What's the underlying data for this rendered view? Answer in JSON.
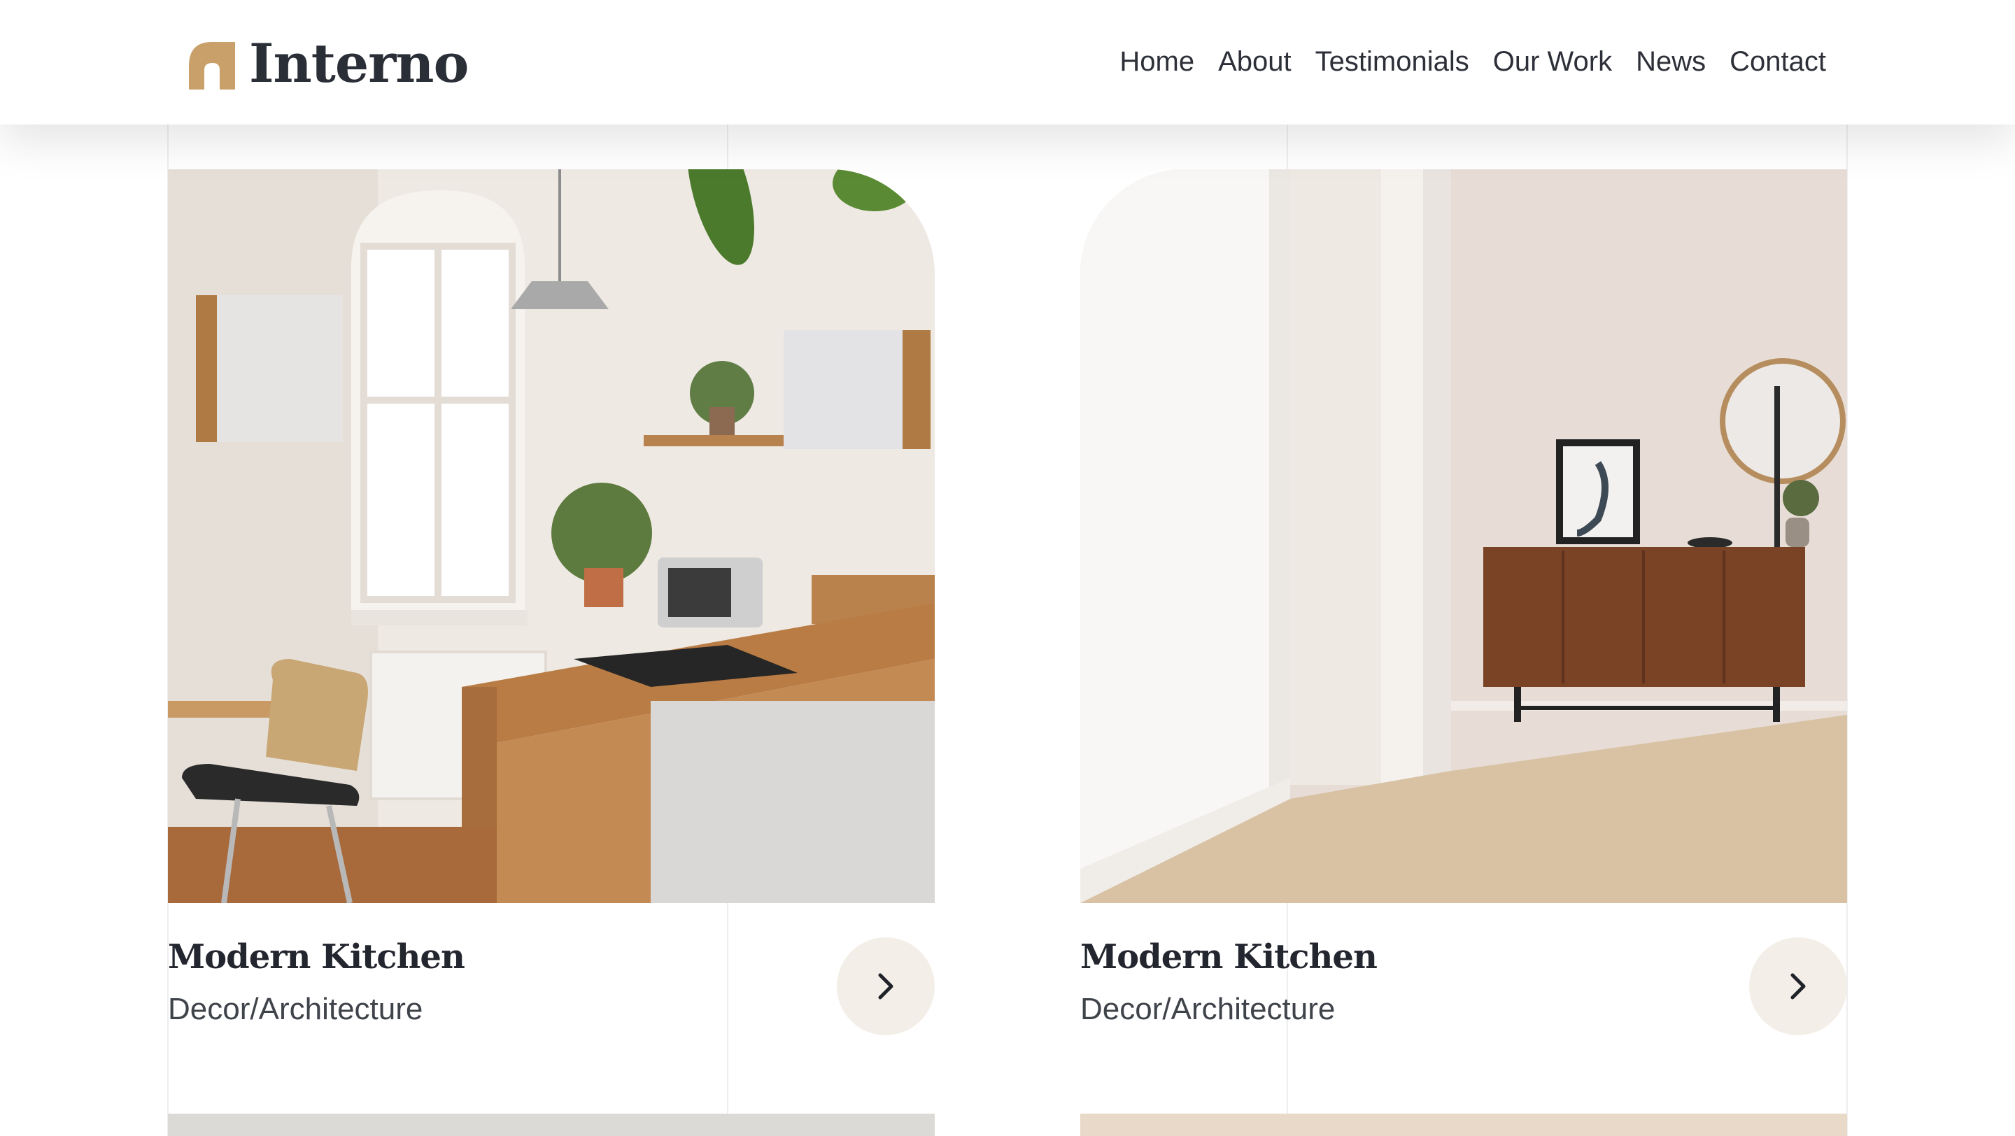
{
  "brand": {
    "name": "Interno",
    "accent_color": "#c9a06a"
  },
  "nav": {
    "items": [
      "Home",
      "About",
      "Testimonials",
      "Our Work",
      "News",
      "Contact"
    ]
  },
  "projects": [
    {
      "title": "Modern Kitchen",
      "category": "Decor/Architecture",
      "image": "kitchen-photo",
      "action_icon": "chevron-right-icon"
    },
    {
      "title": "Modern Kitchen",
      "category": "Decor/Architecture",
      "image": "living-room-photo",
      "action_icon": "chevron-right-icon"
    }
  ],
  "colors": {
    "heading": "#23262e",
    "button_bg": "#f3eee7"
  }
}
